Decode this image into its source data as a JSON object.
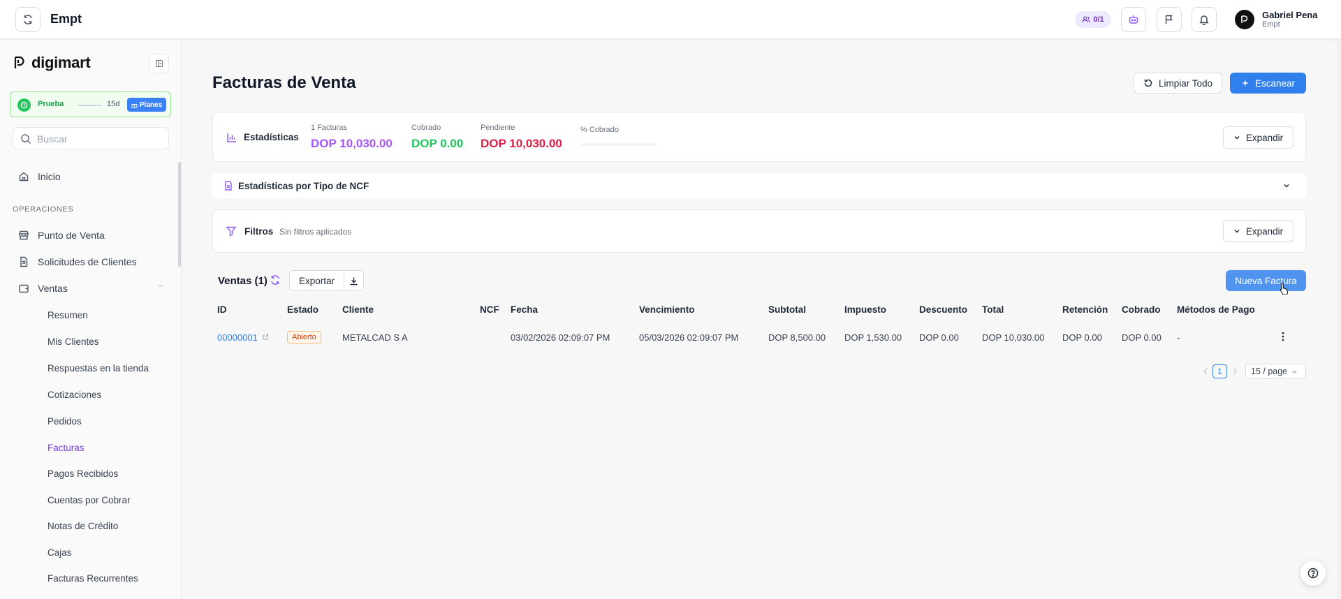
{
  "topbar": {
    "title": "Empt",
    "users_count": "0/1",
    "user_name": "Gabriel Pena",
    "user_org": "Empt"
  },
  "sidebar": {
    "brand": "digimart",
    "trial": {
      "label": "Prueba",
      "days": "15d",
      "plans_label": "Planes"
    },
    "search_placeholder": "Buscar",
    "home": "Inicio",
    "section_operations": "OPERACIONES",
    "items": [
      "Punto de Venta",
      "Solicitudes de Clientes",
      "Ventas"
    ],
    "ventas_sub": [
      "Resumen",
      "Mis Clientes",
      "Respuestas en la tienda",
      "Cotizaciones",
      "Pedidos",
      "Facturas",
      "Pagos Recibidos",
      "Cuentas por Cobrar",
      "Notas de Crédito",
      "Cajas",
      "Facturas Recurrentes"
    ],
    "active_sub": "Facturas"
  },
  "main": {
    "title": "Facturas de Venta",
    "clear_all": "Limpiar Todo",
    "scan": "Escanear",
    "stats": {
      "title": "Estadísticas",
      "invoices_label": "1 Facturas",
      "invoices_value": "DOP 10,030.00",
      "collected_label": "Cobrado",
      "collected_value": "DOP 0.00",
      "pending_label": "Pendiente",
      "pending_value": "DOP 10,030.00",
      "pct_label": "% Cobrado",
      "pct_value": 0,
      "expand": "Expandir"
    },
    "ncf_stats_title": "Estadísticas por Tipo de NCF",
    "filters": {
      "title": "Filtros",
      "subtitle": "Sin filtros aplicados",
      "expand": "Expandir"
    },
    "list": {
      "title": "Ventas (1)",
      "export": "Exportar",
      "new_invoice": "Nueva Factura"
    },
    "table": {
      "headers": [
        "ID",
        "Estado",
        "Cliente",
        "NCF",
        "Fecha",
        "Vencimiento",
        "Subtotal",
        "Impuesto",
        "Descuento",
        "Total",
        "Retención",
        "Cobrado",
        "Métodos de Pago"
      ],
      "rows": [
        [
          "00000001",
          "Abierto",
          "METALCAD S A",
          "",
          "03/02/2026 02:09:07 PM",
          "05/03/2026 02:09:07 PM",
          "DOP 8,500.00",
          "DOP 1,530.00",
          "DOP 0.00",
          "DOP 10,030.00",
          "DOP 0.00",
          "DOP 0.00",
          "-"
        ]
      ]
    },
    "pagination": {
      "current_page": "1",
      "page_size": "15 / page"
    }
  },
  "colors": {
    "primary": "#2f80ed",
    "purple": "#a855f7",
    "green": "#22c55e",
    "red": "#e11d48"
  }
}
